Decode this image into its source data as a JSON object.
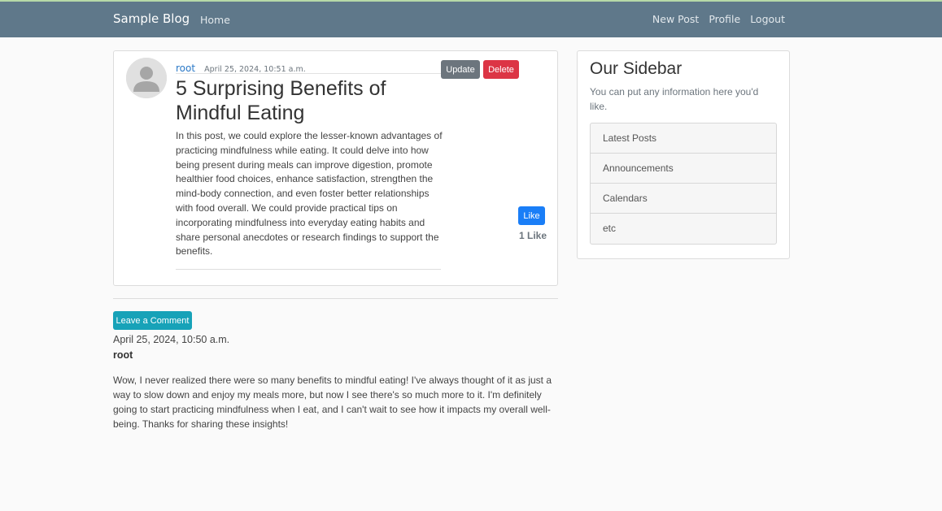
{
  "navbar": {
    "brand": "Sample Blog",
    "home": "Home",
    "new_post": "New Post",
    "profile": "Profile",
    "logout": "Logout"
  },
  "post": {
    "author": "root",
    "date": "April 25, 2024, 10:51 a.m.",
    "update_label": "Update",
    "delete_label": "Delete",
    "title": "5 Surprising Benefits of Mindful Eating",
    "body": "In this post, we could explore the lesser-known advantages of practicing mindfulness while eating. It could delve into how being present during meals can improve digestion, promote healthier food choices, enhance satisfaction, strengthen the mind-body connection, and even foster better relationships with food overall. We could provide practical tips on incorporating mindfulness into everyday eating habits and share personal anecdotes or research findings to support the benefits.",
    "like_label": "Like",
    "like_count": "1 Like"
  },
  "comments": {
    "leave_label": "Leave a Comment",
    "items": [
      {
        "date": "April 25, 2024, 10:50 a.m.",
        "author": "root",
        "body": "Wow, I never realized there were so many benefits to mindful eating! I've always thought of it as just a way to slow down and enjoy my meals more, but now I see there's so much more to it. I'm definitely going to start practicing mindfulness when I eat, and I can't wait to see how it impacts my overall well-being. Thanks for sharing these insights!"
      }
    ]
  },
  "sidebar": {
    "title": "Our Sidebar",
    "text": "You can put any information here you'd like.",
    "items": [
      {
        "label": "Latest Posts"
      },
      {
        "label": "Announcements"
      },
      {
        "label": "Calendars"
      },
      {
        "label": "etc"
      }
    ]
  },
  "colors": {
    "navbar": "#5f788a",
    "update_button": "#6c757d",
    "delete_button": "#dc3545",
    "like_button": "#1a7ef7",
    "comment_button": "#17a2b8",
    "author_link": "#2a78c7"
  }
}
